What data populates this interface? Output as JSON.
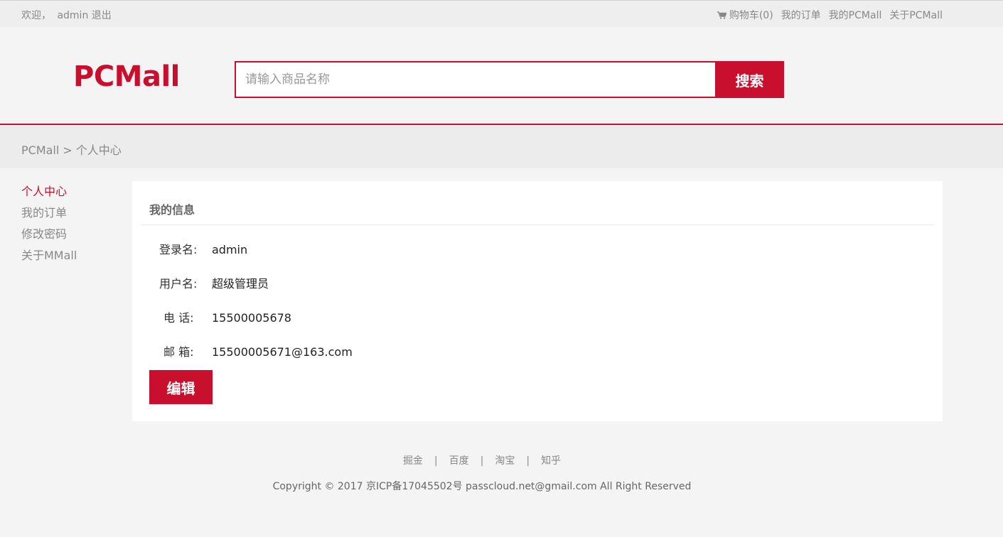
{
  "topbar": {
    "welcome": "欢迎，",
    "username": "admin",
    "logout": "退出",
    "cart": "购物车(0)",
    "my_orders": "我的订单",
    "my_pcmall": "我的PCMall",
    "about": "关于PCMall"
  },
  "header": {
    "logo": "PCMall",
    "search_placeholder": "请输入商品名称",
    "search_button": "搜索"
  },
  "breadcrumb": {
    "home": "PCMall",
    "separator": ">",
    "current": "个人中心"
  },
  "sidebar": {
    "items": [
      {
        "label": "个人中心"
      },
      {
        "label": "我的订单"
      },
      {
        "label": "修改密码"
      },
      {
        "label": "关于MMall"
      }
    ]
  },
  "profile": {
    "title": "我的信息",
    "rows": [
      {
        "label": "登录名:",
        "value": "admin"
      },
      {
        "label": "用户名:",
        "value": "超级管理员"
      },
      {
        "label": "电 话:",
        "value": "15500005678"
      },
      {
        "label": "邮 箱:",
        "value": "15500005671@163.com"
      }
    ],
    "edit_button": "编辑"
  },
  "footer": {
    "links": [
      "掘金",
      "百度",
      "淘宝",
      "知乎"
    ],
    "separator": "|",
    "copyright": "Copyright © 2017 京ICP备17045502号 passcloud.net@gmail.com All Right Reserved"
  },
  "colors": {
    "brand": "#c8102e",
    "background": "#f5f4f4",
    "muted_text": "#888888"
  }
}
